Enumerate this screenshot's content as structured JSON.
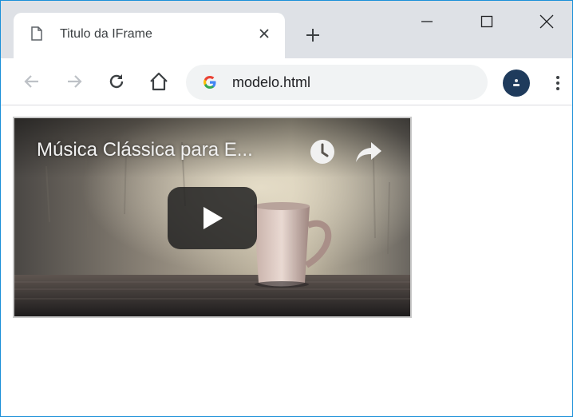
{
  "tab": {
    "title": "Titulo da IFrame",
    "page_icon": "page-icon",
    "close_icon": "close-icon"
  },
  "new_tab_icon": "plus-icon",
  "window_controls": [
    "minimize-icon",
    "maximize-icon",
    "close-icon"
  ],
  "toolbar": {
    "back_icon": "arrow-left-icon",
    "forward_icon": "arrow-right-icon",
    "reload_icon": "reload-icon",
    "home_icon": "home-icon",
    "url": "modelo.html",
    "site_icon": "google-icon",
    "profile_icon": "avatar",
    "menu_icon": "kebab-menu-icon"
  },
  "video": {
    "title": "Música Clássica para E...",
    "watch_later_icon": "clock-icon",
    "share_icon": "share-icon",
    "play_icon": "play-icon"
  },
  "colors": {
    "tabstrip": "#dee1e6",
    "omnibox": "#f1f3f4",
    "window_border": "#1a8fd8",
    "profile": "#1f3b5c"
  }
}
